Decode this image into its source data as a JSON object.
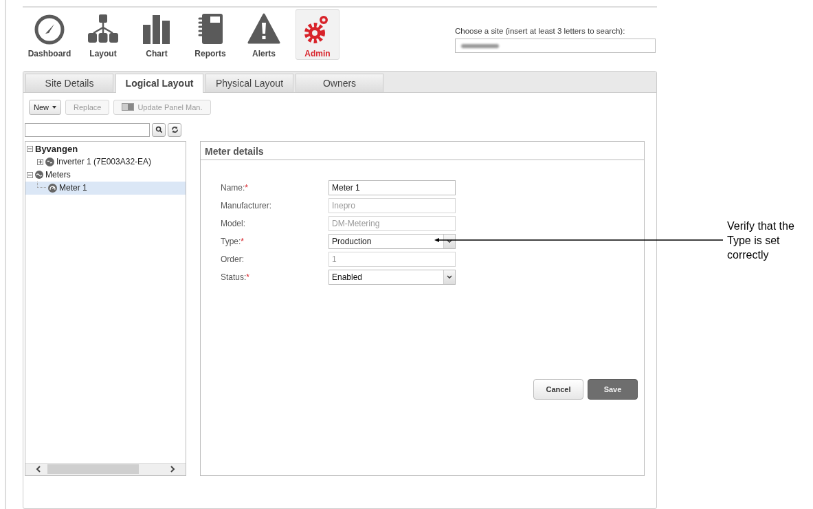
{
  "nav": [
    {
      "kind": "dashboard",
      "label": "Dashboard",
      "selected": false
    },
    {
      "kind": "layout",
      "label": "Layout",
      "selected": false
    },
    {
      "kind": "chart",
      "label": "Chart",
      "selected": false
    },
    {
      "kind": "reports",
      "label": "Reports",
      "selected": false
    },
    {
      "kind": "alerts",
      "label": "Alerts",
      "selected": false
    },
    {
      "kind": "admin",
      "label": "Admin",
      "selected": true
    }
  ],
  "site_search": {
    "label": "Choose a site (insert at least 3 letters to search):"
  },
  "tabs": [
    {
      "label": "Site Details",
      "selected": false
    },
    {
      "label": "Logical Layout",
      "selected": true
    },
    {
      "label": "Physical Layout",
      "selected": false
    },
    {
      "label": "Owners",
      "selected": false
    }
  ],
  "toolbar": [
    {
      "kind": "menu",
      "label": "New",
      "disabled": false
    },
    {
      "kind": "plain",
      "label": "Replace",
      "disabled": true
    },
    {
      "kind": "panel",
      "label": "Update Panel Man.",
      "disabled": true
    }
  ],
  "tree": [
    {
      "label": "Byvangen",
      "kind": "site",
      "expanded": true,
      "selected": false,
      "children": [
        {
          "label": "Inverter 1 (7E003A32-EA)",
          "kind": "inverter",
          "expanded": false,
          "selected": false
        }
      ]
    },
    {
      "label": "Meters",
      "kind": "meters",
      "expanded": true,
      "selected": false,
      "children": [
        {
          "label": "Meter 1",
          "kind": "meter",
          "selected": true
        }
      ]
    }
  ],
  "details": {
    "title": "Meter details",
    "fields": [
      {
        "label": "Name:",
        "required": true,
        "kind": "text",
        "value": "Meter 1",
        "disabled": false
      },
      {
        "label": "Manufacturer:",
        "required": false,
        "kind": "text",
        "value": "Inepro",
        "disabled": true
      },
      {
        "label": "Model:",
        "required": false,
        "kind": "text",
        "value": "DM-Metering",
        "disabled": true
      },
      {
        "label": "Type:",
        "required": true,
        "kind": "select",
        "value": "Production",
        "disabled": false
      },
      {
        "label": "Order:",
        "required": false,
        "kind": "text",
        "value": "1",
        "disabled": true
      },
      {
        "label": "Status:",
        "required": true,
        "kind": "select",
        "value": "Enabled",
        "disabled": false
      }
    ],
    "required_mark": "*",
    "buttons": [
      {
        "kind": "secondary",
        "label": "Cancel"
      },
      {
        "kind": "primary",
        "label": "Save"
      }
    ]
  },
  "callout": {
    "text": "Verify that the Type is set correctly"
  }
}
